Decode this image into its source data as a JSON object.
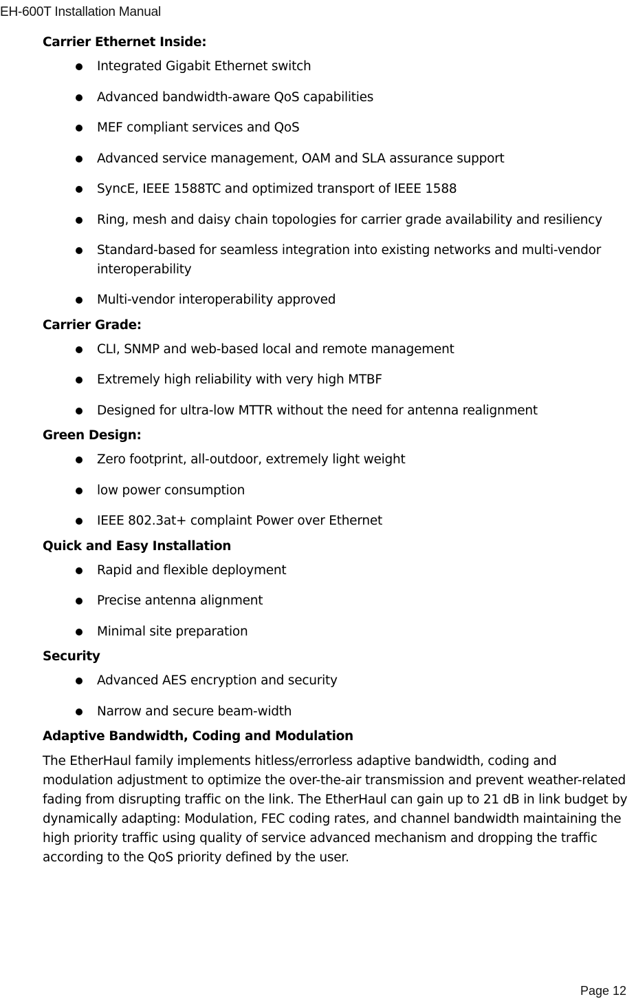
{
  "header": {
    "running_title": "EH-600T Installation Manual"
  },
  "footer": {
    "page_label": "Page 12"
  },
  "sections": [
    {
      "heading": "Carrier Ethernet Inside:",
      "bullets": [
        "Integrated Gigabit Ethernet switch",
        "Advanced bandwidth-aware QoS capabilities",
        "MEF compliant services and QoS",
        "Advanced service management, OAM and SLA assurance support",
        "SyncE, IEEE 1588TC and  optimized transport of IEEE 1588",
        "Ring, mesh and daisy chain topologies for carrier grade availability and resiliency",
        "Standard-based for seamless integration into existing networks and multi-vendor interoperability",
        "Multi-vendor interoperability approved"
      ]
    },
    {
      "heading": "Carrier Grade:",
      "bullets": [
        "CLI, SNMP and  web-based local and remote management",
        "Extremely high reliability with very high MTBF",
        "Designed for ultra-low MTTR without the need for antenna realignment"
      ]
    },
    {
      "heading": "Green Design:",
      "bullets": [
        "Zero footprint, all-outdoor, extremely light weight",
        "low power consumption",
        "IEEE 802.3at+ complaint  Power over Ethernet"
      ]
    },
    {
      "heading": "Quick and Easy Installation",
      "bullets": [
        "Rapid and flexible deployment",
        "Precise antenna alignment",
        "Minimal site preparation"
      ]
    },
    {
      "heading": "Security",
      "bullets": [
        "Advanced AES encryption and security",
        "Narrow and secure beam-width"
      ]
    },
    {
      "heading": "Adaptive Bandwidth, Coding and Modulation",
      "bullets": [],
      "paragraph": "The EtherHaul family implements hitless/errorless adaptive bandwidth, coding and modulation adjustment to optimize the over-the-air transmission and prevent weather-related fading from disrupting traffic on the link. The EtherHaul can gain up to 21 dB in link budget by dynamically adapting: Modulation, FEC coding rates, and channel bandwidth maintaining the high priority traffic using quality of service advanced mechanism and dropping the traffic according to the QoS priority defined by the user."
    }
  ]
}
